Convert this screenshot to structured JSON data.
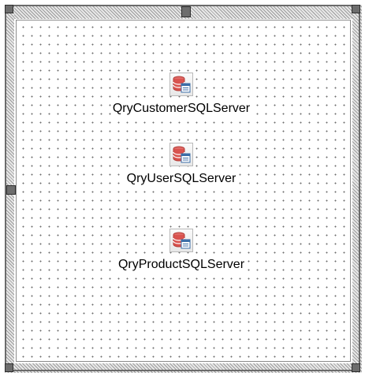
{
  "form": {
    "components": [
      {
        "name": "QryCustomerSQLServer",
        "icon": "database-query-icon"
      },
      {
        "name": "QryUserSQLServer",
        "icon": "database-query-icon"
      },
      {
        "name": "QryProductSQLServer",
        "icon": "database-query-icon"
      }
    ]
  },
  "colors": {
    "db_icon_red": "#d9534f",
    "grid_dot": "#6e6e6e",
    "handle": "#6d6d6d"
  }
}
